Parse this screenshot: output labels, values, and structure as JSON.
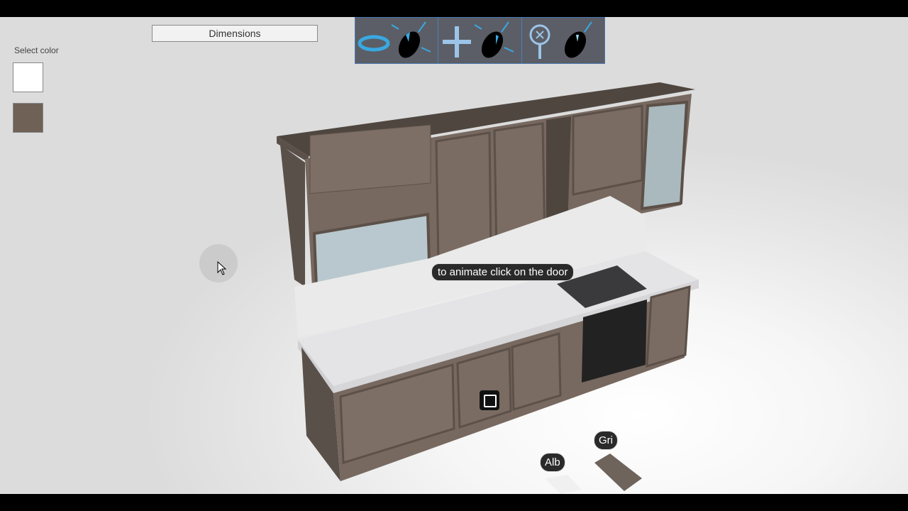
{
  "toolbar": {
    "dimensions_label": "Dimensions",
    "icons": [
      "rotate-mouse-left-icon",
      "pan-mouse-right-icon",
      "zoom-mouse-wheel-icon"
    ]
  },
  "color_panel": {
    "label": "Select color",
    "swatches": [
      {
        "name": "white",
        "color": "#ffffff"
      },
      {
        "name": "brown-grey",
        "color": "#6f6156"
      }
    ]
  },
  "viewport": {
    "hint": "to animate click on the door",
    "materials": [
      {
        "label": "Alb",
        "color": "#f0f0f0"
      },
      {
        "label": "Gri",
        "color": "#6e645c"
      }
    ]
  },
  "colors": {
    "cabinet": "#6f6156",
    "countertop": "#e8e8ea",
    "toolbar_bg": "#5b5e66",
    "accent": "#3aa8e0"
  }
}
